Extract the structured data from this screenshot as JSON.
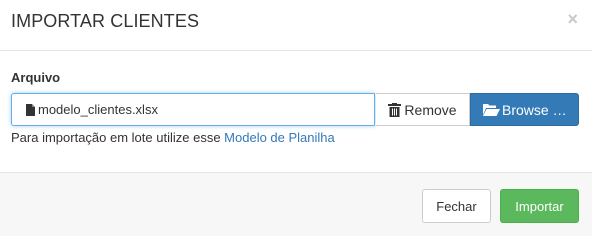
{
  "modal": {
    "title": "IMPORTAR CLIENTES",
    "close_symbol": "×",
    "close_icon": "close-icon"
  },
  "form": {
    "field_label": "Arquivo",
    "file_value": "modelo_clientes.xlsx",
    "file_icon": "file-icon",
    "remove_label": "Remove",
    "remove_icon": "trash-icon",
    "browse_label": "Browse …",
    "browse_icon": "folder-open-icon",
    "help_text": "Para importação em lote utilize esse",
    "help_link": "Modelo de Planilha"
  },
  "footer": {
    "close_label": "Fechar",
    "import_label": "Importar"
  },
  "colors": {
    "primary": "#337ab7",
    "success": "#5cb85c",
    "focus_border": "#66afe9",
    "link": "#337ab7"
  }
}
